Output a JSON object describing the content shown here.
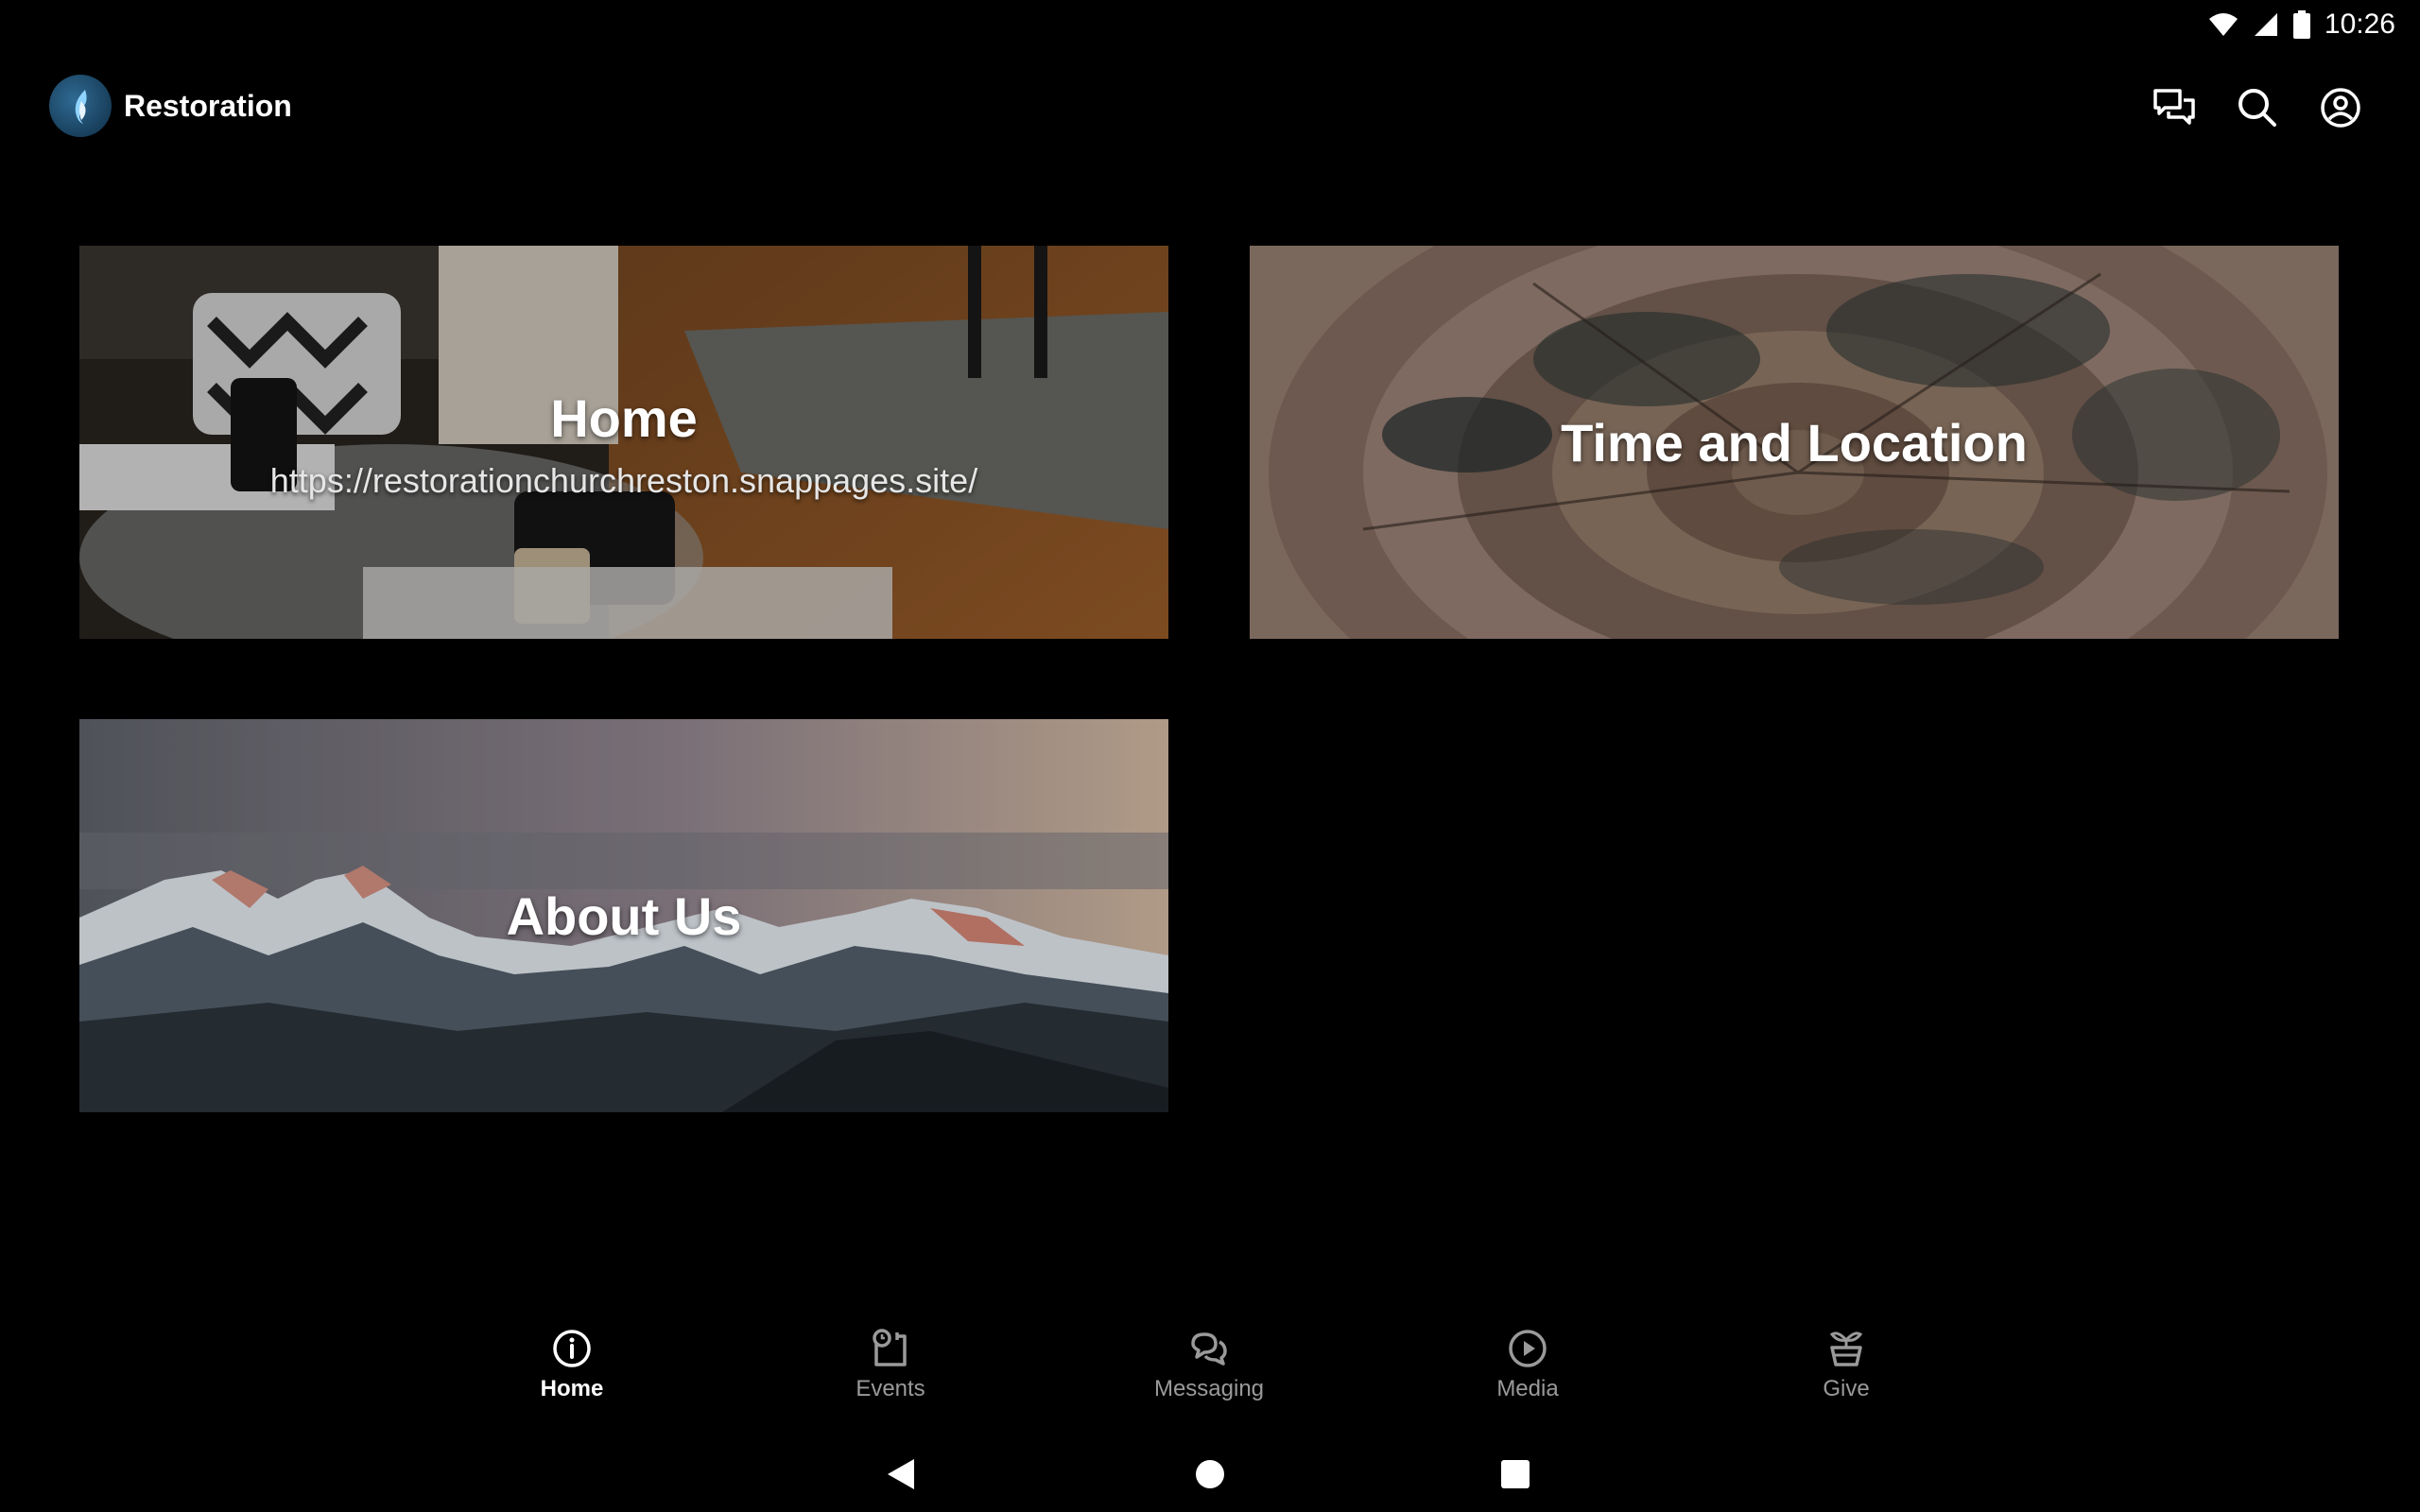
{
  "status_bar": {
    "time": "10:26",
    "icons": [
      "wifi-icon",
      "signal-icon",
      "battery-icon"
    ]
  },
  "app_bar": {
    "title": "Restoration",
    "actions": [
      "chat-icon",
      "search-icon",
      "account-icon"
    ]
  },
  "cards": [
    {
      "title": "Home",
      "subtitle": "https://restorationchurchreston.snappages.site/"
    },
    {
      "title": "Time and Location",
      "subtitle": ""
    },
    {
      "title": "About Us",
      "subtitle": ""
    }
  ],
  "bottom_nav": {
    "active": "Home",
    "items": [
      {
        "label": "Home",
        "icon": "info-icon"
      },
      {
        "label": "Events",
        "icon": "calendar-clock-icon"
      },
      {
        "label": "Messaging",
        "icon": "messaging-icon"
      },
      {
        "label": "Media",
        "icon": "play-circle-icon"
      },
      {
        "label": "Give",
        "icon": "give-plant-icon"
      }
    ]
  },
  "colors": {
    "background": "#000000",
    "text": "#ffffff",
    "inactive_nav": "#9a9a9a",
    "logo": "#1f4f73"
  }
}
